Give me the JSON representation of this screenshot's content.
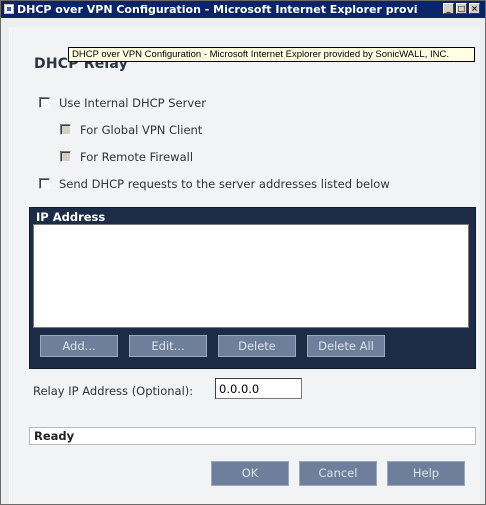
{
  "window": {
    "title": "DHCP over VPN Configuration - Microsoft Internet Explorer provided by So..."
  },
  "tooltip": {
    "text": "DHCP over VPN Configuration - Microsoft Internet Explorer provided by SonicWALL, INC."
  },
  "section": {
    "title": "DHCP Relay"
  },
  "options": {
    "use_internal": {
      "label": "Use Internal DHCP Server",
      "checked": false
    },
    "global_vpn": {
      "label": "For Global VPN Client",
      "checked": false,
      "enabled": false
    },
    "remote_firewall": {
      "label": "For Remote Firewall",
      "checked": false,
      "enabled": false
    },
    "send_requests": {
      "label": "Send DHCP requests to the server addresses listed below",
      "checked": false
    }
  },
  "ip_table": {
    "header": "IP Address",
    "rows": [],
    "buttons": {
      "add": "Add...",
      "edit": "Edit...",
      "delete": "Delete",
      "delete_all": "Delete All"
    }
  },
  "relay": {
    "label": "Relay IP Address (Optional):",
    "value": "0.0.0.0"
  },
  "status": {
    "text": "Ready"
  },
  "footer": {
    "ok": "OK",
    "cancel": "Cancel",
    "help": "Help"
  },
  "colors": {
    "titlebar": "#0a246a",
    "panel": "#1c2b46",
    "button": "#6d7f9a"
  },
  "icons": {
    "app": "ie-window-icon",
    "minimize": "minimize-icon",
    "maximize": "maximize-icon",
    "close": "close-icon"
  }
}
